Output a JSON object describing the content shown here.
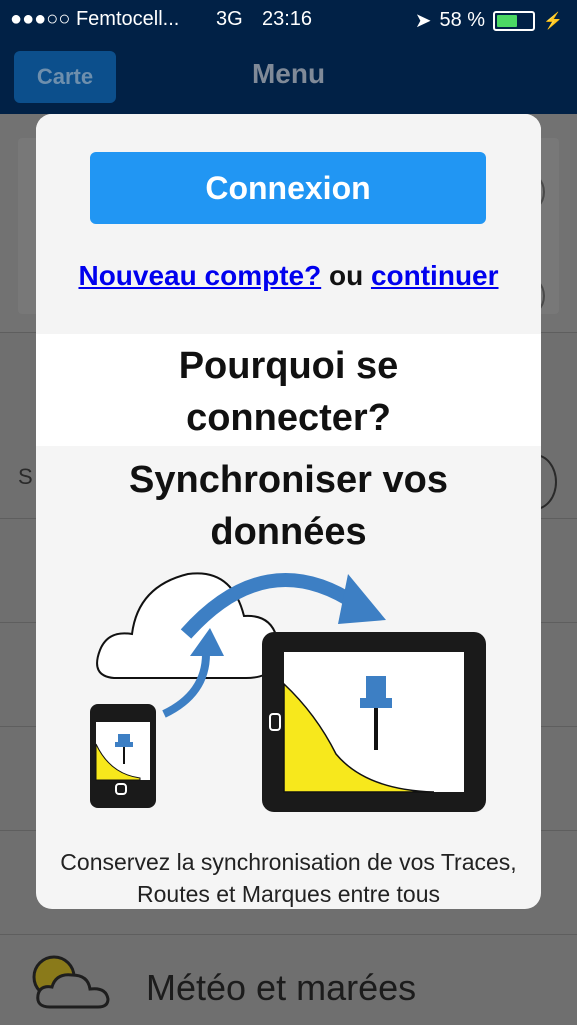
{
  "status": {
    "carrier": "●●●○○ Femtocell...",
    "network": "3G",
    "time": "23:16",
    "battery_text": "58 %",
    "battery_level": 0.58
  },
  "nav": {
    "back_label": "Carte",
    "title": "Menu"
  },
  "background": {
    "letter": "S",
    "meteo_label": "Météo et marées"
  },
  "modal": {
    "login_button": "Connexion",
    "new_account_link": "Nouveau compte?",
    "or_text": " ou ",
    "continue_link": "continuer",
    "heading_why": "Pourquoi se connecter?",
    "heading_sync": "Synchroniser vos données",
    "description": "Conservez la synchronisation de vos Traces, Routes et Marques entre tous"
  },
  "colors": {
    "primary_blue": "#2196f3",
    "nav_dark": "#012146",
    "link_blue": "#0000ee",
    "arrow_blue": "#3d7fc4",
    "fill_yellow": "#f7e81c"
  }
}
